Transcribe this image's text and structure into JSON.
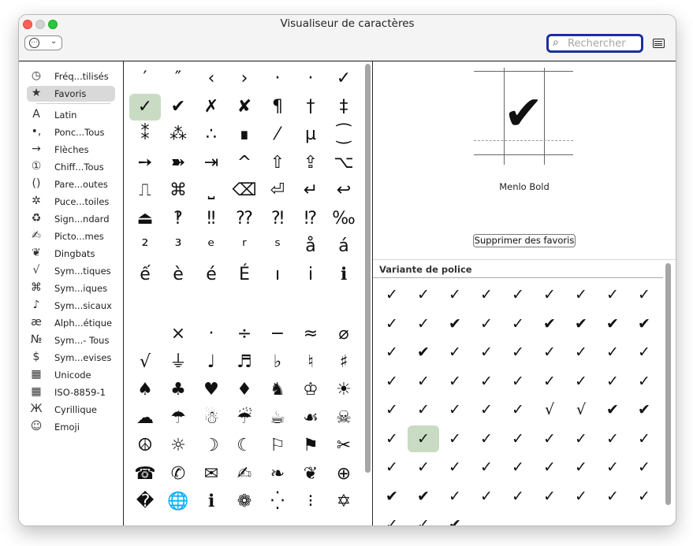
{
  "window": {
    "title": "Visualiseur de caractères"
  },
  "toolbar": {
    "action_dots": "⋯",
    "action_chevron": "⌄",
    "search_icon": "⌕",
    "search_placeholder": "Rechercher"
  },
  "sidebar": {
    "items": [
      {
        "icon": "◷",
        "icon_name": "clock-icon",
        "label": "Fréq...tilisés"
      },
      {
        "icon": "★",
        "icon_name": "star-icon",
        "label": "Favoris",
        "selected": true
      },
      {
        "icon": "A",
        "icon_name": "latin-letter-icon",
        "label": "Latin"
      },
      {
        "icon": "•,",
        "icon_name": "punctuation-icon",
        "label": "Ponc...Tous"
      },
      {
        "icon": "→",
        "icon_name": "arrow-icon",
        "label": "Flèches"
      },
      {
        "icon": "①",
        "icon_name": "circled-number-icon",
        "label": "Chiff...Tous"
      },
      {
        "icon": "()",
        "icon_name": "parentheses-icon",
        "label": "Pare...outes"
      },
      {
        "icon": "✲",
        "icon_name": "asterisk-star-icon",
        "label": "Puce...toiles"
      },
      {
        "icon": "♻",
        "icon_name": "recycle-icon",
        "label": "Sign...ndard"
      },
      {
        "icon": "✍",
        "icon_name": "pictograph-icon",
        "label": "Picto...mes"
      },
      {
        "icon": "❦",
        "icon_name": "dingbat-heart-icon",
        "label": "Dingbats"
      },
      {
        "icon": "√",
        "icon_name": "math-root-icon",
        "label": "Sym...tiques"
      },
      {
        "icon": "⌘",
        "icon_name": "command-icon",
        "label": "Sym...iques"
      },
      {
        "icon": "♪",
        "icon_name": "music-note-icon",
        "label": "Sym...sicaux"
      },
      {
        "icon": "æ",
        "icon_name": "phonetic-icon",
        "label": "Alph...étique"
      },
      {
        "icon": "№",
        "icon_name": "numero-icon",
        "label": "Sym...- Tous"
      },
      {
        "icon": "$",
        "icon_name": "currency-icon",
        "label": "Sym...evises"
      },
      {
        "icon": "▦",
        "icon_name": "unicode-grid-icon",
        "label": "Unicode"
      },
      {
        "icon": "▦",
        "icon_name": "iso-grid-icon",
        "label": "ISO-8859-1"
      },
      {
        "icon": "Ж",
        "icon_name": "cyrillic-icon",
        "label": "Cyrillique"
      },
      {
        "icon": "☺",
        "icon_name": "emoji-icon",
        "label": "Emoji"
      }
    ]
  },
  "favorites": {
    "section1": [
      "′",
      "″",
      "‹",
      "›",
      "·",
      "·",
      "✓",
      "✓",
      "✔",
      "✗",
      "✘",
      "¶",
      "†",
      "‡",
      "⁑",
      "⁂",
      "∴",
      "∎",
      "⁄",
      "µ",
      "⁐",
      "➙",
      "➽",
      "⇥",
      "^",
      "⇧",
      "⇪",
      "⌥",
      "⎍",
      "⌘",
      "⎵",
      "⌫",
      "⏎",
      "↵",
      "↩",
      "⏏",
      "‽",
      "‼",
      "⁇",
      "⁈",
      "⁉",
      "‰",
      "²",
      "³",
      "ᵉ",
      "ʳ",
      "ˢ",
      "å",
      "á",
      "ế",
      "è",
      "é",
      "É",
      "ı",
      "i",
      "ℹ"
    ],
    "section2": [
      "",
      "×",
      "·",
      "÷",
      "−",
      "≈",
      "⌀",
      "√",
      "⏚",
      "♩",
      "♬",
      "♭",
      "♮",
      "♯",
      "♠",
      "♣",
      "♥",
      "♦",
      "♞",
      "♔",
      "☀",
      "☁",
      "☂",
      "☃",
      "☔",
      "☕",
      "☙",
      "☠",
      "☮",
      "☼",
      "☽",
      "☾",
      "⚐",
      "⚑",
      "✂",
      "☎",
      "✆",
      "✉",
      "✍",
      "❧",
      "❦",
      "⊕",
      "�",
      "🌐",
      "ℹ",
      "❁",
      "⁛",
      "⁝",
      "✡"
    ]
  },
  "preview": {
    "glyph": "✔",
    "font_name": "Menlo Bold",
    "remove_button": "Supprimer des favoris"
  },
  "variants": {
    "title": "Variante de police",
    "cells": [
      "✓",
      "✓",
      "✓",
      "✓",
      "✓",
      "✓",
      "✓",
      "✓",
      "✓",
      "✓",
      "✓",
      "✔",
      "✓",
      "✓",
      "✔",
      "✔",
      "✔",
      "✔",
      "✓",
      "✔",
      "✓",
      "✓",
      "✓",
      "✓",
      "✓",
      "✓",
      "✓",
      "✓",
      "✓",
      "✓",
      "✓",
      "✓",
      "✓",
      "✓",
      "✓",
      "✓",
      "✓",
      "✓",
      "✓",
      "✓",
      "✓",
      "√",
      "√",
      "✔",
      "✔",
      "✓",
      "✓",
      "✓",
      "✓",
      "✓",
      "✓",
      "✓",
      "✓",
      "✓",
      "✓",
      "✓",
      "✓",
      "✓",
      "✓",
      "✓",
      "✓",
      "✓",
      "✓",
      "✔",
      "✔",
      "✓",
      "✓",
      "✓",
      "✓",
      "✓",
      "✓",
      "✓",
      "✓",
      "✓",
      "✔",
      "",
      "",
      "",
      "",
      "",
      ""
    ]
  }
}
